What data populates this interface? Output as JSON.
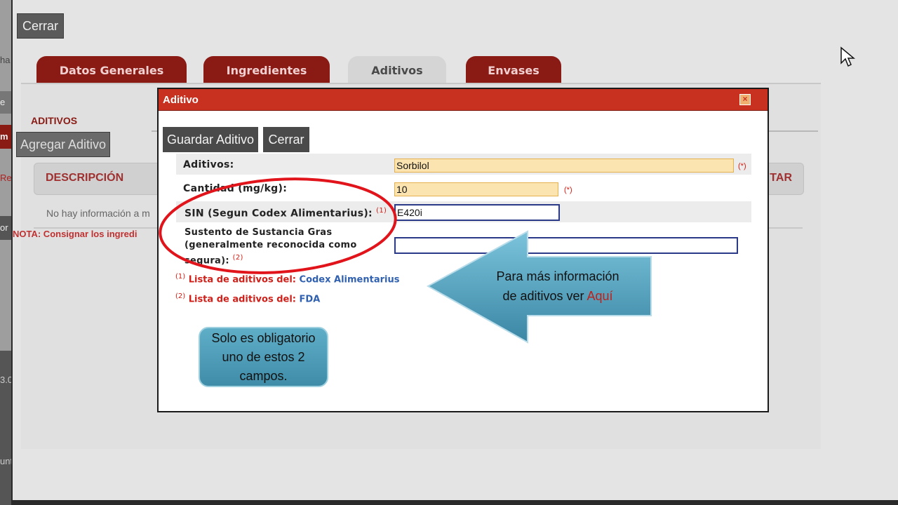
{
  "background": {
    "close_button": "Cerrar",
    "tabs": [
      {
        "label": "Datos Generales"
      },
      {
        "label": "Ingredientes"
      },
      {
        "label": "Aditivos"
      },
      {
        "label": "Envases"
      }
    ],
    "section_title": "ADITIVOS",
    "add_button": "Agregar Aditivo",
    "table_header": "DESCRIPCIÓN",
    "table_header_right": "TAR",
    "empty_text": "No hay información a m",
    "note_text": "NOTA: Consignar los ingredi",
    "strip_frags": [
      "ha",
      "e",
      "m",
      "Re",
      "or",
      "3.0",
      "unt"
    ]
  },
  "modal": {
    "title": "Aditivo",
    "close_x": "×",
    "save_button": "Guardar Aditivo",
    "cancel_button": "Cerrar",
    "fields": {
      "aditivos": {
        "label": "Aditivos:",
        "value": "Sorbilol",
        "required": "(*)"
      },
      "cantidad": {
        "label": "Cantidad (mg/kg):",
        "value": "10",
        "required": "(*)"
      },
      "sin": {
        "label": "SIN (Segun Codex Alimentarius):",
        "sup": "(1)",
        "value": "E420i"
      },
      "sustento": {
        "label_line1": "Sustento de Sustancia Gras",
        "label_line2": "(generalmente reconocida como",
        "label_line3": "segura):",
        "sup": "(2)",
        "value": ""
      }
    },
    "notes": [
      {
        "sup": "(1)",
        "text": "Lista de aditivos del:",
        "link": "Codex Alimentarius"
      },
      {
        "sup": "(2)",
        "text": "Lista de aditivos del:",
        "link": "FDA"
      }
    ]
  },
  "annotations": {
    "callout": "Solo es obligatorio uno de estos 2 campos.",
    "arrow_text_1": "Para más información",
    "arrow_text_2": "de aditivos ver",
    "arrow_link": "Aquí"
  }
}
